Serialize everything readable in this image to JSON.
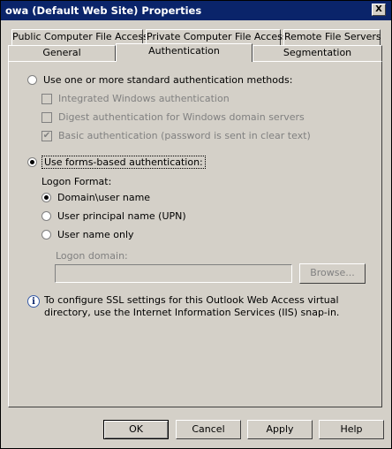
{
  "window": {
    "title": "owa (Default Web Site) Properties",
    "close_label": "X"
  },
  "tabs_row1": [
    {
      "label": "Public Computer File Access"
    },
    {
      "label": "Private Computer File Access"
    },
    {
      "label": "Remote File Servers"
    }
  ],
  "tabs_row2": [
    {
      "label": "General"
    },
    {
      "label": "Authentication",
      "active": true
    },
    {
      "label": "Segmentation"
    }
  ],
  "auth": {
    "standard_methods_label": "Use one or more standard authentication methods:",
    "integrated_label": "Integrated Windows authentication",
    "digest_label": "Digest authentication for Windows domain servers",
    "basic_label": "Basic authentication (password is sent in clear text)",
    "basic_checked": true,
    "forms_based_label": "Use forms-based authentication:",
    "forms_based_selected": true,
    "logon_format_label": "Logon Format:",
    "format_domain_user": "Domain\\user name",
    "format_upn": "User principal name (UPN)",
    "format_username_only": "User name only",
    "selected_format": "Domain\\user name",
    "logon_domain_label": "Logon domain:",
    "logon_domain_value": "",
    "browse_label": "Browse..."
  },
  "info_text": "To configure SSL settings for this Outlook Web Access virtual directory, use the Internet Information Services (IIS) snap-in.",
  "buttons": {
    "ok": "OK",
    "cancel": "Cancel",
    "apply": "Apply",
    "help": "Help"
  }
}
